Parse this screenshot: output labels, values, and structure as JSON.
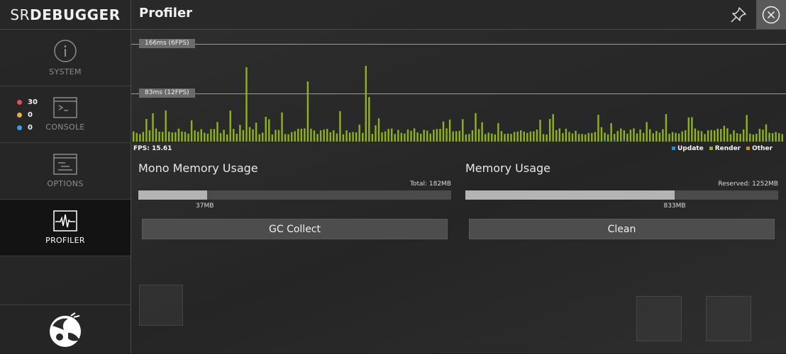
{
  "app": {
    "logo_sr": "SR",
    "logo_debugger": "DEBUGGER"
  },
  "header": {
    "title": "Profiler"
  },
  "sidebar": {
    "tabs": [
      {
        "label": "SYSTEM",
        "icon": "info-icon"
      },
      {
        "label": "CONSOLE",
        "icon": "console-icon"
      },
      {
        "label": "OPTIONS",
        "icon": "options-icon"
      },
      {
        "label": "PROFILER",
        "icon": "profiler-icon",
        "active": true
      }
    ],
    "counts": [
      {
        "value": "30",
        "color": "#e85050"
      },
      {
        "value": "0",
        "color": "#e8b040"
      },
      {
        "value": "0",
        "color": "#3c9be6"
      }
    ]
  },
  "graph": {
    "line_top_label": "166ms (6FPS)",
    "line_mid_label": "83ms (12FPS)",
    "fps_text": "FPS: 15.61",
    "legend": [
      {
        "label": "Update",
        "color": "#2f8fd6"
      },
      {
        "label": "Render",
        "color": "#8fb31e"
      },
      {
        "label": "Other",
        "color": "#d28a1e"
      }
    ]
  },
  "memory": {
    "mono": {
      "title": "Mono Memory Usage",
      "total": "Total: 182MB",
      "used": "37MB",
      "fraction": 0.22,
      "button": "GC Collect"
    },
    "system": {
      "title": "Memory Usage",
      "reserved": "Reserved: 1252MB",
      "used": "833MB",
      "fraction": 0.67,
      "button": "Clean"
    }
  },
  "colors": {
    "bar": "#8fb31e",
    "update": "#2f8fd6",
    "accent": "#e85050"
  }
}
